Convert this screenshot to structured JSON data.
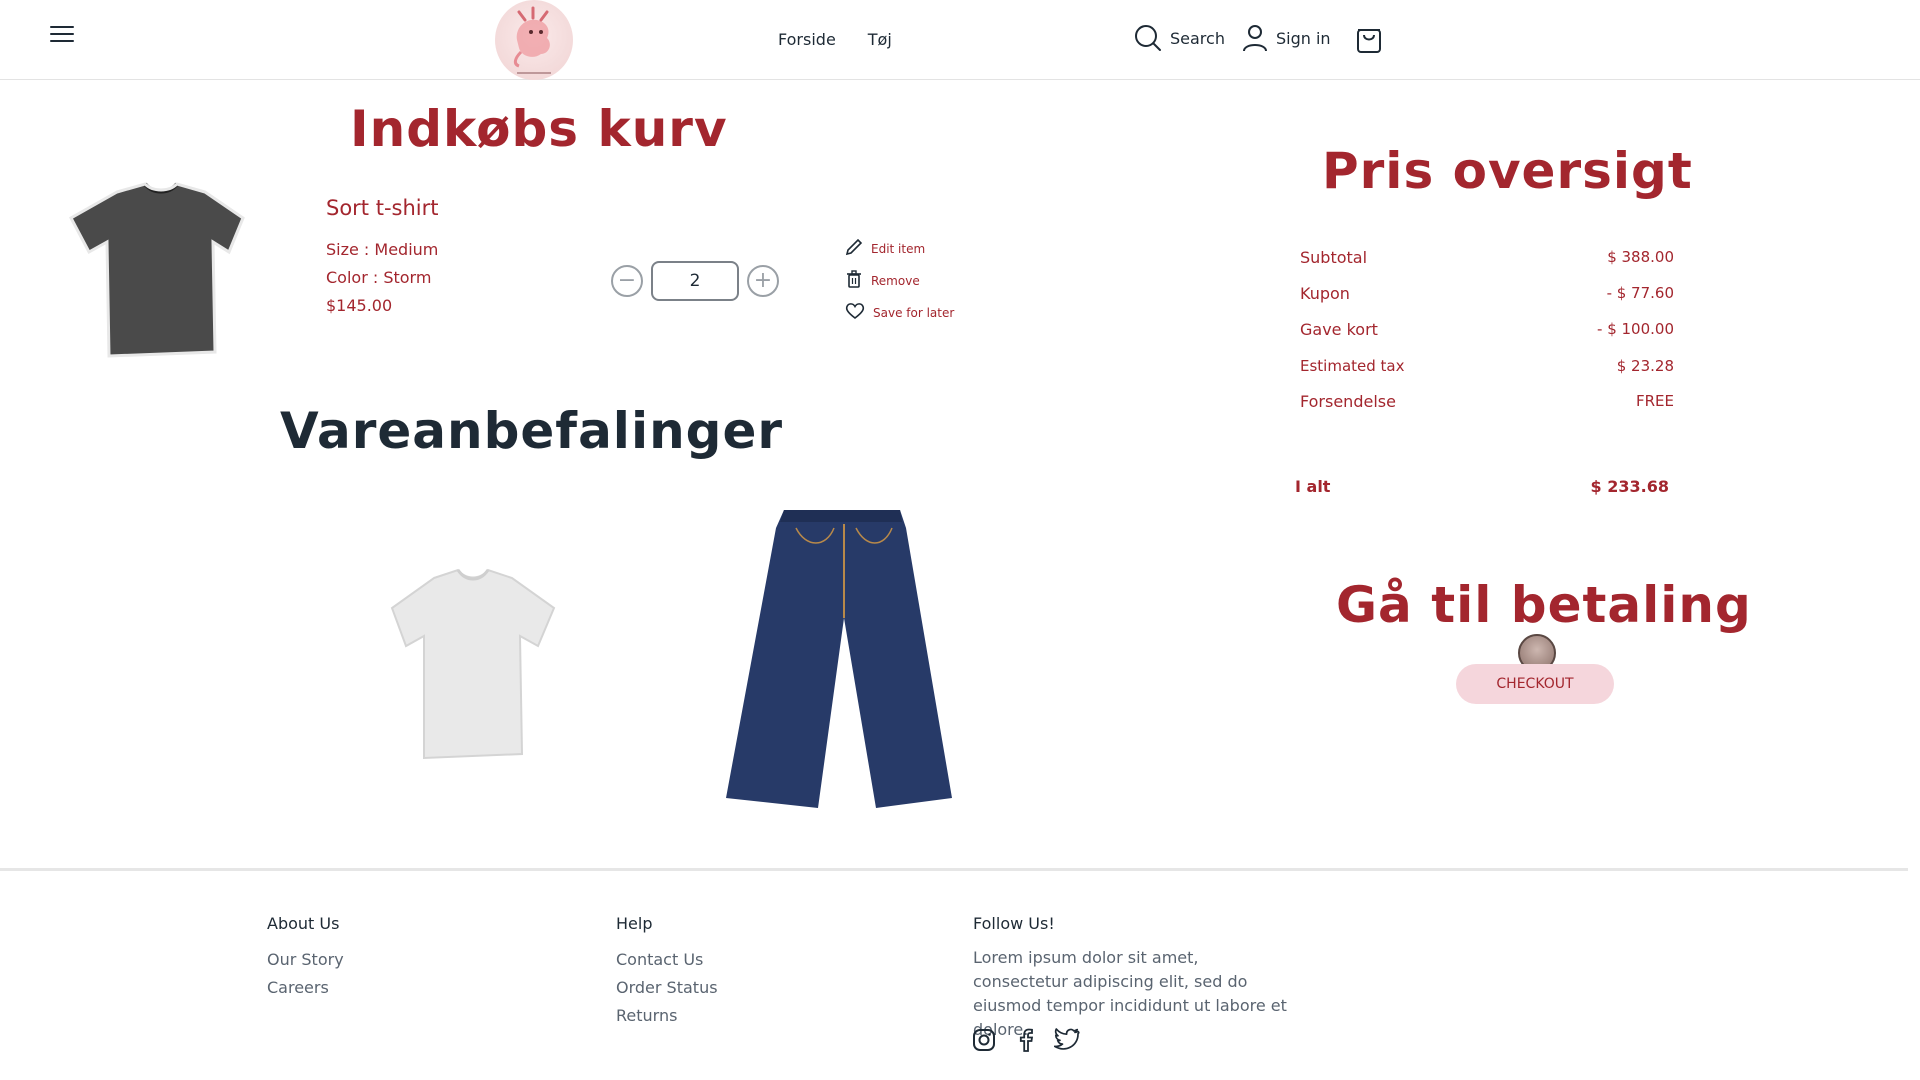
{
  "header": {
    "nav": [
      {
        "label": "Forside"
      },
      {
        "label": "Tøj"
      }
    ],
    "search_label": "Search",
    "signin_label": "Sign in"
  },
  "cart": {
    "heading": "Indkøbs kurv",
    "item": {
      "name": "Sort t-shirt",
      "size": "Size : Medium",
      "color": "Color : Storm",
      "price": "$145.00",
      "quantity": "2",
      "actions": {
        "edit": "Edit item",
        "remove": "Remove",
        "save": "Save for later"
      }
    }
  },
  "recommendations": {
    "heading": "Vareanbefalinger",
    "items": [
      {
        "name": "white-tshirt"
      },
      {
        "name": "jeans"
      }
    ]
  },
  "price_overview": {
    "heading": "Pris oversigt",
    "rows": [
      {
        "label": "Subtotal",
        "value": "$ 388.00"
      },
      {
        "label": "Kupon",
        "value": "- $ 77.60"
      },
      {
        "label": "Gave kort",
        "value": "- $ 100.00"
      },
      {
        "label": "Estimated tax",
        "value": "$ 23.28"
      },
      {
        "label": "Forsendelse",
        "value": "FREE"
      }
    ],
    "total_label": "I alt",
    "total_value": "$ 233.68"
  },
  "payment": {
    "heading": "Gå til betaling",
    "checkout_label": "CHECKOUT"
  },
  "footer": {
    "about": {
      "title": "About Us",
      "links": [
        "Our Story",
        "Careers"
      ]
    },
    "help": {
      "title": "Help",
      "links": [
        "Contact Us",
        "Order Status",
        "Returns"
      ]
    },
    "follow": {
      "title": "Follow Us!",
      "text": "Lorem ipsum dolor sit amet, consectetur adipiscing elit, sed do eiusmod tempor incididunt ut labore et dolore."
    }
  },
  "colors": {
    "accent": "#a3262e",
    "dark": "#1e2a35",
    "checkout_bg": "#f5d6dc"
  }
}
